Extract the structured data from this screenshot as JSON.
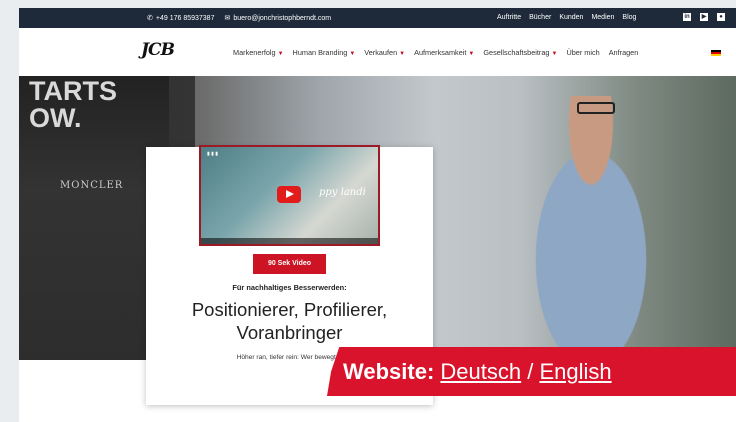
{
  "topbar": {
    "phone": "+49 176 85937387",
    "email": "buero@jonchristophberndt.com",
    "links": [
      "Auftritte",
      "Bücher",
      "Kunden",
      "Medien",
      "Blog"
    ]
  },
  "nav": {
    "logo": "JCB",
    "items": [
      {
        "label": "Markenerfolg",
        "dropdown": true
      },
      {
        "label": "Human Branding",
        "dropdown": true
      },
      {
        "label": "Verkaufen",
        "dropdown": true
      },
      {
        "label": "Aufmerksamkeit",
        "dropdown": true
      },
      {
        "label": "Gesellschaftsbeitrag",
        "dropdown": true
      },
      {
        "label": "Über mich",
        "dropdown": false
      },
      {
        "label": "Anfragen",
        "dropdown": false
      }
    ]
  },
  "hero": {
    "store_text": "TARTS\nOW.",
    "store_sign": "MONCLER"
  },
  "card": {
    "video_overlay_text": "ppy landi",
    "video_button": "90 Sek Video",
    "tagline": "Für nachhaltiges Besserwerden:",
    "headline_line1": "Positionierer, Profilierer,",
    "headline_line2": "Voranbringer",
    "subtext": "Höher ran, tiefer rein: Wer bewegt w"
  },
  "banner": {
    "label": "Website:",
    "link_de": "Deutsch",
    "separator": " / ",
    "link_en": "English"
  },
  "colors": {
    "topbar_bg": "#1e2a3a",
    "accent_red": "#cc1424",
    "banner_red": "#d9132b"
  }
}
